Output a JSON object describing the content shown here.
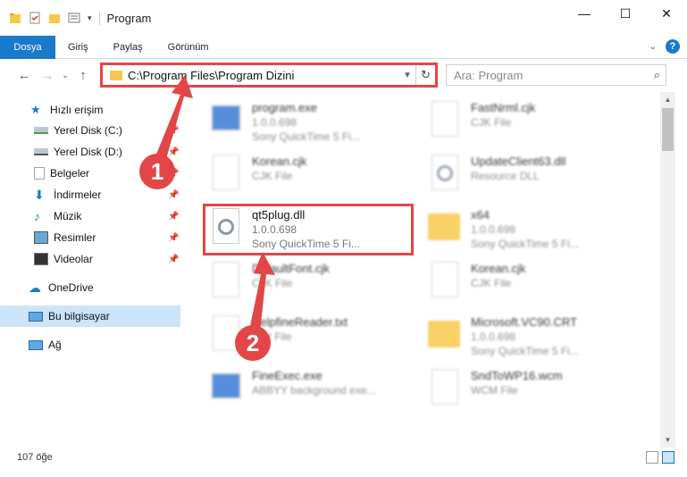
{
  "window": {
    "title": "Program"
  },
  "ribbon": {
    "tabs": [
      "Dosya",
      "Giriş",
      "Paylaş",
      "Görünüm"
    ]
  },
  "address": {
    "path": "C:\\Program Files\\Program Dizini"
  },
  "search": {
    "placeholder": "Ara: Program"
  },
  "sidebar": {
    "items": [
      {
        "label": "Hızlı erişim"
      },
      {
        "label": "Yerel Disk (C:)"
      },
      {
        "label": "Yerel Disk (D:)"
      },
      {
        "label": "Belgeler"
      },
      {
        "label": "İndirmeler"
      },
      {
        "label": "Müzik"
      },
      {
        "label": "Resimler"
      },
      {
        "label": "Videolar"
      },
      {
        "label": "OneDrive"
      },
      {
        "label": "Bu bilgisayar"
      },
      {
        "label": "Ağ"
      }
    ]
  },
  "files": [
    {
      "name": "program.exe",
      "line2": "1.0.0.698",
      "line3": "Sony QuickTime 5 Fi..."
    },
    {
      "name": "FastNrml.cjk",
      "line2": "CJK File",
      "line3": ""
    },
    {
      "name": "Korean.cjk",
      "line2": "CJK File",
      "line3": ""
    },
    {
      "name": "UpdateClient63.dll",
      "line2": "Resource DLL",
      "line3": ""
    },
    {
      "name": "qt5plug.dll",
      "line2": "1.0.0.698",
      "line3": "Sony QuickTime 5 Fi..."
    },
    {
      "name": "x64",
      "line2": "1.0.0.698",
      "line3": "Sony QuickTime 5 Fi..."
    },
    {
      "name": "DefaultFont.cjk",
      "line2": "CJK File",
      "line3": ""
    },
    {
      "name": "Korean.cjk",
      "line2": "CJK File",
      "line3": ""
    },
    {
      "name": "HelpfineReader.txt",
      "line2": "Text File",
      "line3": ""
    },
    {
      "name": "Microsoft.VC90.CRT",
      "line2": "1.0.0.698",
      "line3": "Sony QuickTime 5 Fi..."
    },
    {
      "name": "FineExec.exe",
      "line2": "ABBYY background exe...",
      "line3": ""
    },
    {
      "name": "SndToWP16.wcm",
      "line2": "WCM File",
      "line3": ""
    }
  ],
  "status": {
    "count": "107 öğe"
  },
  "annotations": {
    "step1": "1",
    "step2": "2"
  },
  "colors": {
    "accent": "#1979ca",
    "highlight": "#e34646",
    "folder": "#f7c84b"
  }
}
